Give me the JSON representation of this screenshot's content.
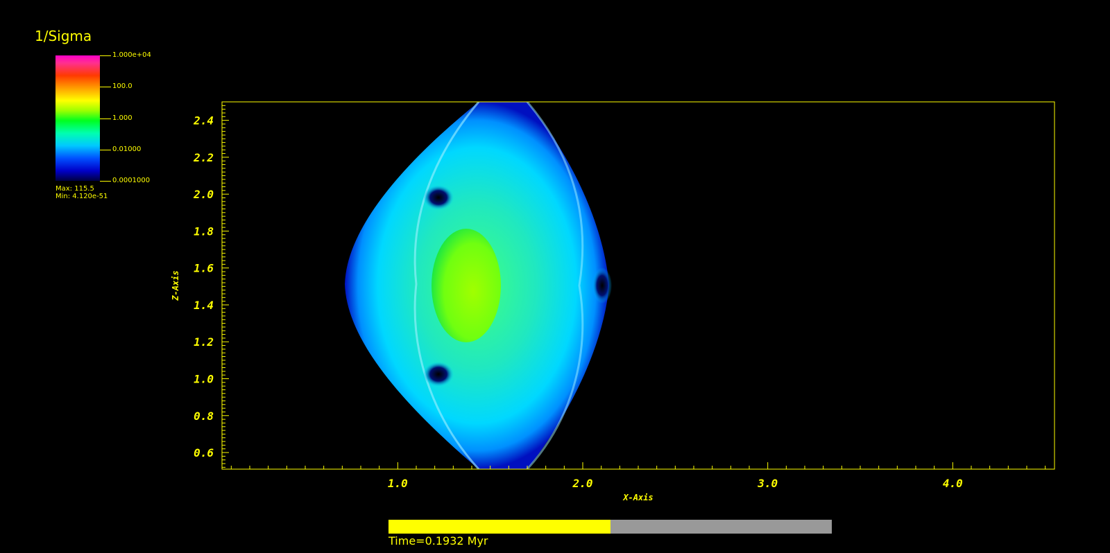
{
  "legend": {
    "title": "1/Sigma",
    "ticks": [
      "1.000e+04",
      "100.0",
      "1.000",
      "0.01000",
      "0.0001000"
    ],
    "max_label": "Max:  115.5",
    "min_label": "Min:  4.120e-51"
  },
  "progress": {
    "fraction": 0.5,
    "label": "Time=0.1932 Myr"
  },
  "colors": {
    "axis": "#ffff00",
    "background": "#000000",
    "progress_track": "#999999"
  },
  "chart_data": {
    "type": "heatmap",
    "title": "",
    "xlabel": "X-Axis",
    "ylabel": "Z-Axis",
    "xlim": [
      0.05,
      4.55
    ],
    "ylim": [
      0.51,
      2.5
    ],
    "x_ticks": [
      "1.0",
      "2.0",
      "3.0",
      "4.0"
    ],
    "y_ticks": [
      "0.6",
      "0.8",
      "1.0",
      "1.2",
      "1.4",
      "1.6",
      "1.8",
      "2.0",
      "2.2",
      "2.4"
    ],
    "colorscale": "log",
    "color_range": [
      0.0001,
      10000
    ],
    "field_max": 115.5,
    "field_min": 4.12e-51
  }
}
